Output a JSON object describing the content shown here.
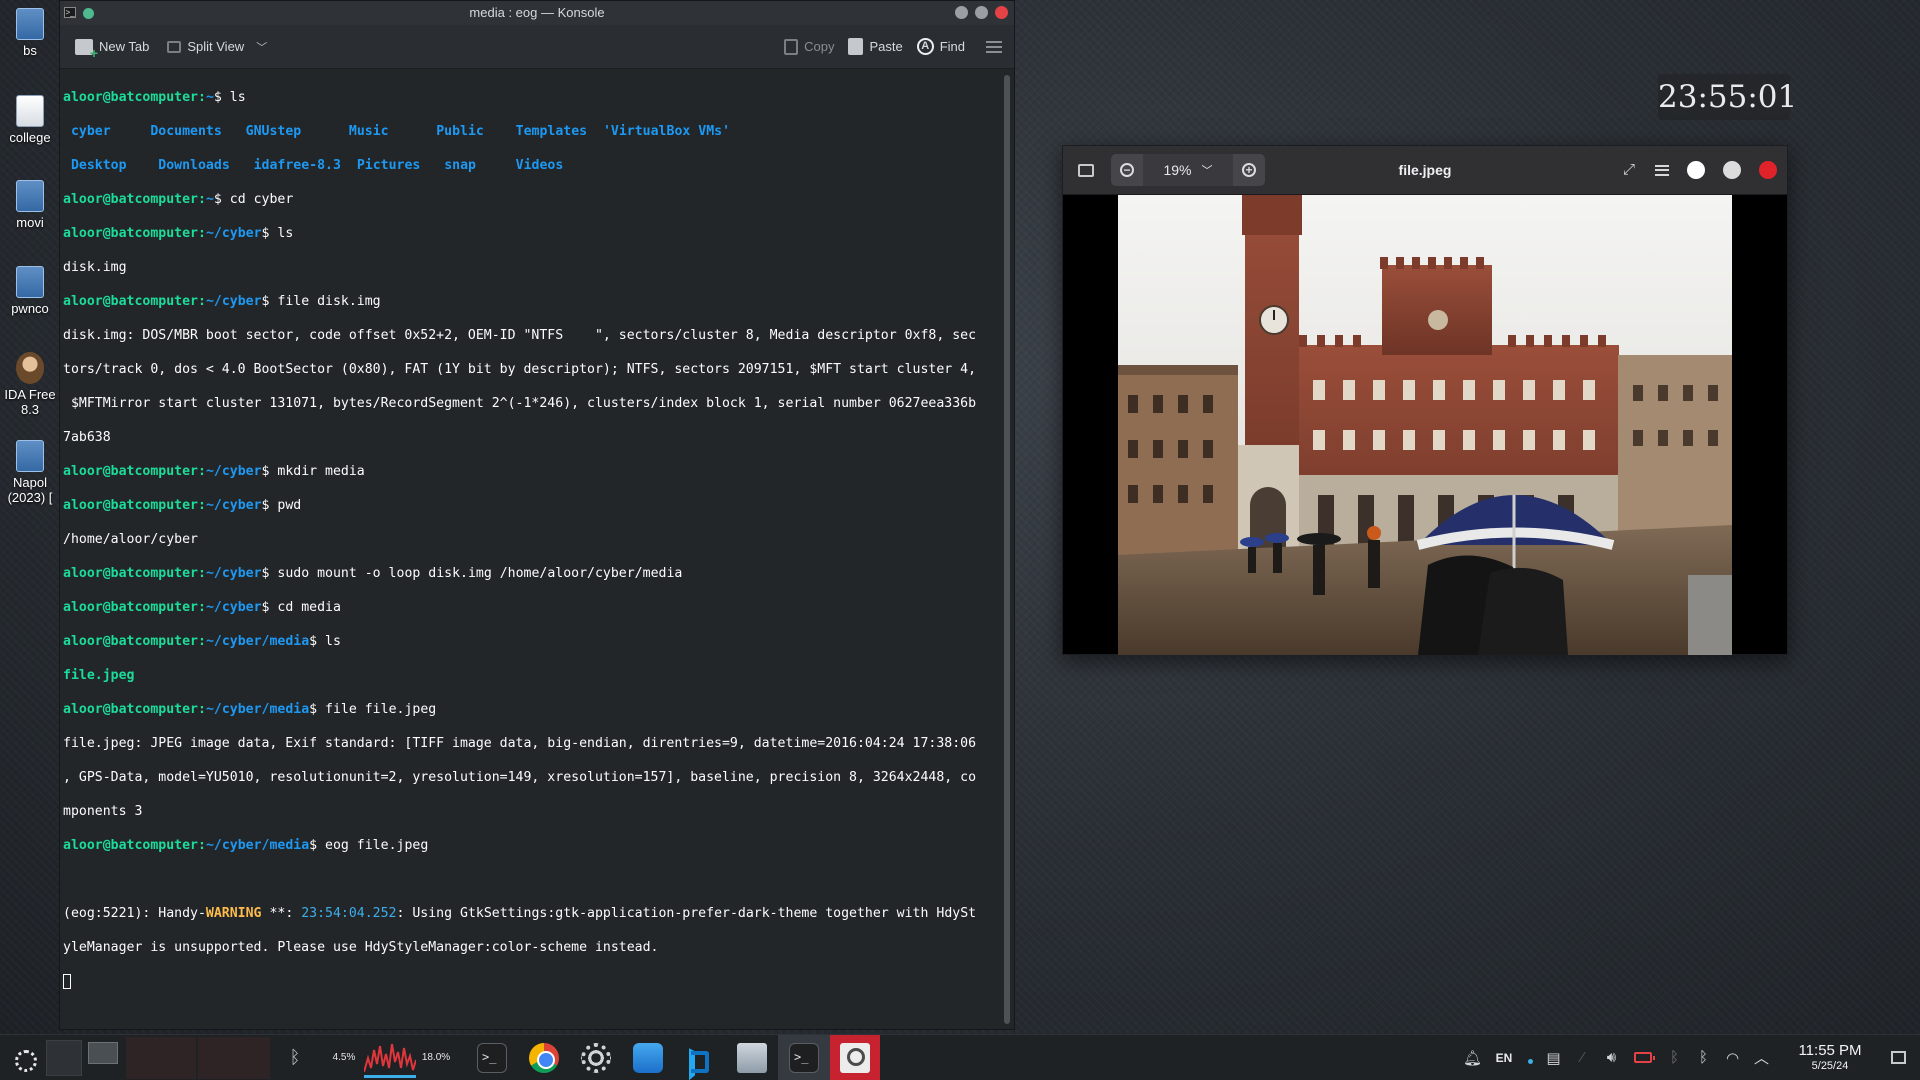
{
  "desktop": {
    "icons": [
      {
        "label": "bs",
        "kind": "file"
      },
      {
        "label": "college",
        "kind": "doc"
      },
      {
        "label": "movi",
        "kind": "file"
      },
      {
        "label": "pwnco",
        "kind": "file"
      },
      {
        "label": "IDA Free",
        "label2": "8.3",
        "kind": "face"
      },
      {
        "label": "Napol",
        "label2": "(2023) [",
        "kind": "file"
      }
    ]
  },
  "konsole": {
    "title": "media : eog — Konsole",
    "toolbar": {
      "new_tab": "New Tab",
      "split_view": "Split View",
      "copy": "Copy",
      "paste": "Paste",
      "find": "Find"
    },
    "prompt": {
      "user": "aloor@batcomputer",
      "home": "~",
      "cyber": "~/cyber",
      "media": "~/cyber/media"
    },
    "commands": {
      "ls": "ls",
      "cd_cyber": "cd cyber",
      "file_disk": "file disk.img",
      "mkdir": "mkdir media",
      "pwd": "pwd",
      "mount": "sudo mount -o loop disk.img /home/aloor/cyber/media",
      "cd_media": "cd media",
      "file_jpeg": "file file.jpeg",
      "eog": "eog file.jpeg"
    },
    "ls_home_row1": [
      "cyber",
      "Documents",
      "GNUstep",
      "Music",
      "Public",
      "Templates",
      "'VirtualBox VMs'"
    ],
    "ls_home_row2": [
      "Desktop",
      "Downloads",
      "idafree-8.3",
      "Pictures",
      "snap",
      "Videos"
    ],
    "ls_cyber": "disk.img",
    "file_disk_output": [
      "disk.img: DOS/MBR boot sector, code offset 0x52+2, OEM-ID \"NTFS    \", sectors/cluster 8, Media descriptor 0xf8, sec",
      "tors/track 0, dos < 4.0 BootSector (0x80), FAT (1Y bit by descriptor); NTFS, sectors 2097151, $MFT start cluster 4,",
      " $MFTMirror start cluster 131071, bytes/RecordSegment 2^(-1*246), clusters/index block 1, serial number 0627eea336b",
      "7ab638"
    ],
    "pwd_output": "/home/aloor/cyber",
    "ls_media": "file.jpeg",
    "file_jpeg_output": [
      "file.jpeg: JPEG image data, Exif standard: [TIFF image data, big-endian, direntries=9, datetime=2016:04:24 17:38:06",
      ", GPS-Data, model=YU5010, resolutionunit=2, yresolution=149, xresolution=157], baseline, precision 8, 3264x2448, co",
      "mponents 3"
    ],
    "warning": {
      "prefix": "(eog:5221): Handy-",
      "level": "WARNING",
      "mid": " **: ",
      "time": "23:54:04.252",
      "msg": ": Using GtkSettings:gtk-application-prefer-dark-theme together with HdySt",
      "msg2": "yleManager is unsupported. Please use HdyStyleManager:color-scheme instead."
    }
  },
  "clock_widget": {
    "time": "23:55:01"
  },
  "viewer": {
    "title": "file.jpeg",
    "zoom": "19%"
  },
  "taskbar": {
    "cpu_left": "4.5%",
    "cpu_right": "18.0%",
    "tray_lang": "EN",
    "clock_time": "11:55 PM",
    "clock_date": "5/25/24"
  }
}
